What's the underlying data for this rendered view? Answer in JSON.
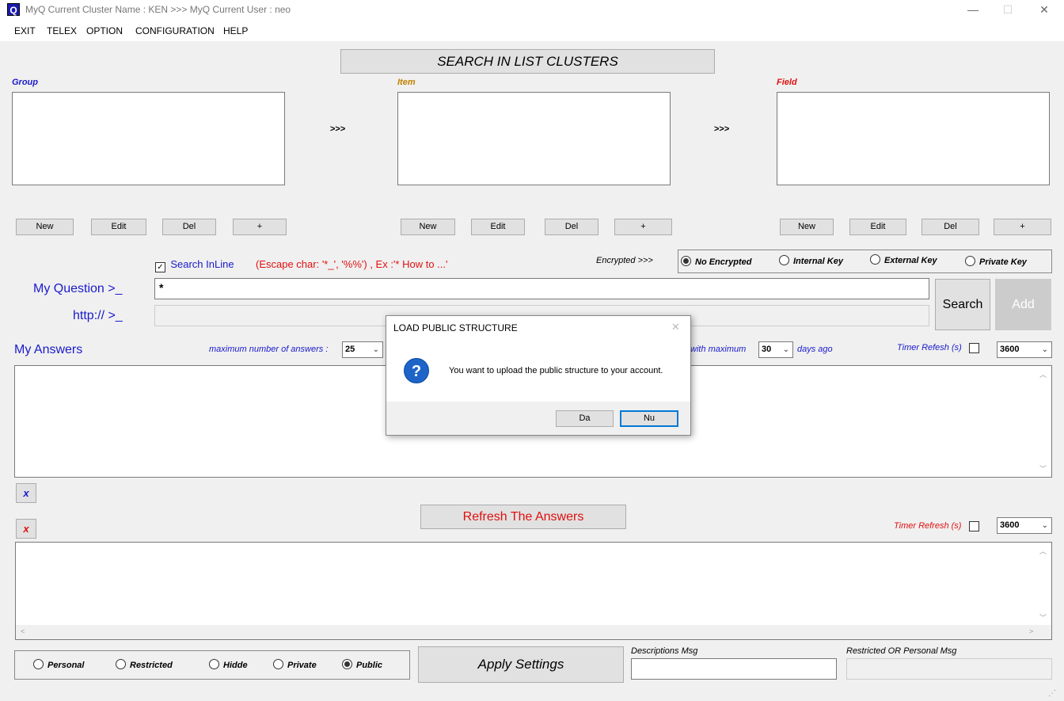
{
  "window": {
    "title": "MyQ Current Cluster Name : KEN >>> MyQ Current User : neo",
    "icon_letter": "Q",
    "minimize_glyph": "—",
    "maximize_glyph": "☐",
    "close_glyph": "✕"
  },
  "menu": [
    "EXIT",
    "TELEX",
    "OPTION",
    "CONFIGURATION",
    "HELP"
  ],
  "search_clusters_button": "SEARCH IN LIST CLUSTERS",
  "panels": {
    "group": {
      "label": "Group",
      "color": "#1a1acc"
    },
    "item": {
      "label": "Item",
      "color": "#c08000"
    },
    "field": {
      "label": "Field",
      "color": "#e01010"
    },
    "arrow_label": ">>>"
  },
  "panel_buttons": [
    "New",
    "Edit",
    "Del",
    "+"
  ],
  "search_inline": {
    "label": "Search InLine",
    "checked": true,
    "check_glyph": "✓"
  },
  "escape_hint": "(Escape char: '*_', '%%') , Ex :'* How to ...'",
  "encrypted_label": "Encrypted >>>",
  "encryption_options": [
    {
      "label": "No Encrypted",
      "selected": true
    },
    {
      "label": "Internal Key",
      "selected": false
    },
    {
      "label": "External Key",
      "selected": false
    },
    {
      "label": "Private Key",
      "selected": false
    }
  ],
  "question": {
    "label": "My Question >_",
    "value": "*"
  },
  "http": {
    "label": "http:// >_",
    "value": ""
  },
  "search_button": "Search",
  "add_button": "Add",
  "answers": {
    "label": "My Answers",
    "max_answers_label": "maximum number of answers :",
    "max_answers_value": "25",
    "with_maximum_label": "with maximum",
    "days_value": "30",
    "days_ago_label": "days ago",
    "timer_label": "Timer Refesh (s)",
    "timer_checked": false,
    "timer_value": "3600"
  },
  "clear_button_1": "x",
  "clear_button_2": "x",
  "refresh_button": "Refresh The Answers",
  "timer2": {
    "label": "Timer Refresh (s)",
    "checked": false,
    "value": "3600"
  },
  "visibility_options": [
    {
      "label": "Personal",
      "selected": false
    },
    {
      "label": "Restricted",
      "selected": false
    },
    {
      "label": "Hidde",
      "selected": false
    },
    {
      "label": "Private",
      "selected": false
    },
    {
      "label": "Public",
      "selected": true
    }
  ],
  "apply_button": "Apply Settings",
  "descriptions_label": "Descriptions Msg",
  "descriptions_value": "",
  "restricted_label": "Restricted OR Personal Msg",
  "restricted_value": "",
  "dialog": {
    "title": "LOAD PUBLIC STRUCTURE",
    "close_glyph": "✕",
    "icon_glyph": "?",
    "message": "You want to upload the public structure to your account.",
    "yes_button": "Da",
    "no_button": "Nu"
  },
  "scroll_glyphs": {
    "up": "︿",
    "down": "﹀",
    "left": "<",
    "right": ">",
    "grip": "⋰"
  }
}
